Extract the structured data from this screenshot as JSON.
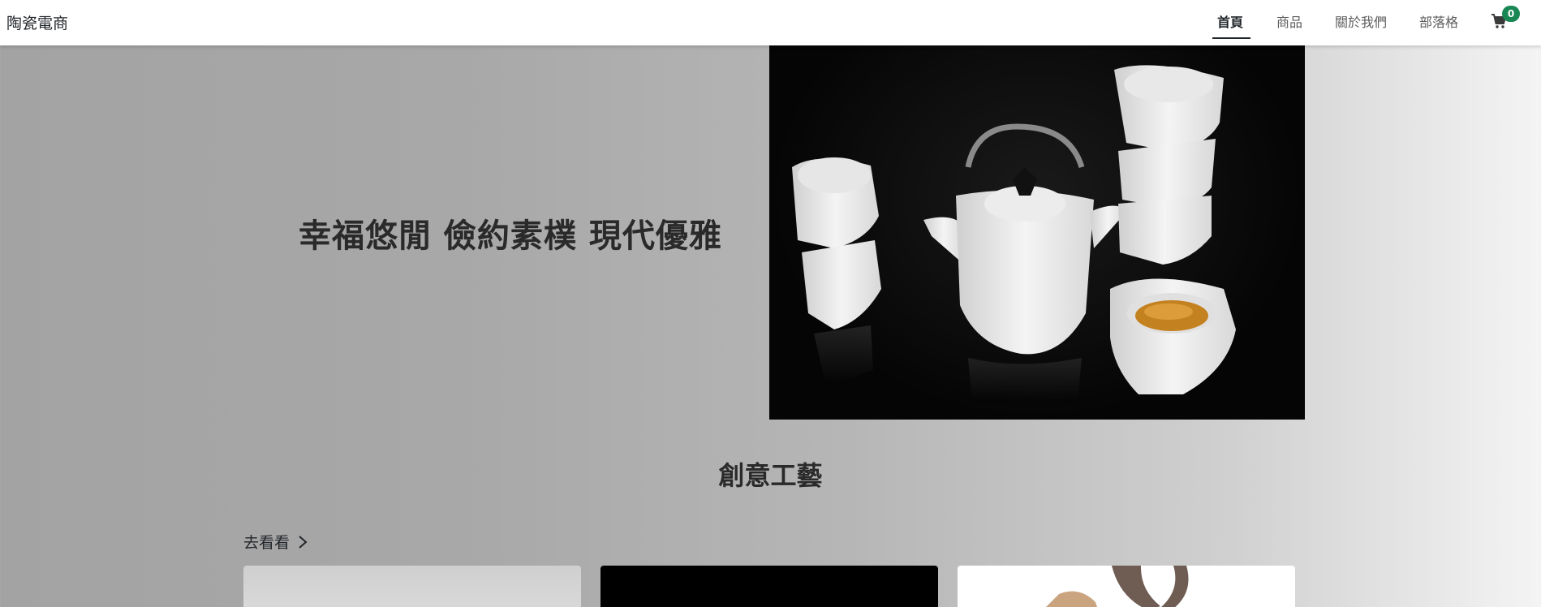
{
  "brand": "陶瓷電商",
  "nav": {
    "items": [
      {
        "label": "首頁",
        "active": true
      },
      {
        "label": "商品",
        "active": false
      },
      {
        "label": "關於我們",
        "active": false
      },
      {
        "label": "部落格",
        "active": false
      }
    ],
    "cart_icon": "cart-icon",
    "cart_count": "0"
  },
  "hero": {
    "title": "幸福悠閒 儉約素樸 現代優雅",
    "image_icon": "teapot-set-image"
  },
  "section": {
    "title": "創意工藝",
    "see_more": "去看看",
    "see_more_icon": "chevron-right-icon"
  },
  "colors": {
    "badge": "#198754",
    "navbar_bg": "#ffffff",
    "text": "#212529"
  }
}
